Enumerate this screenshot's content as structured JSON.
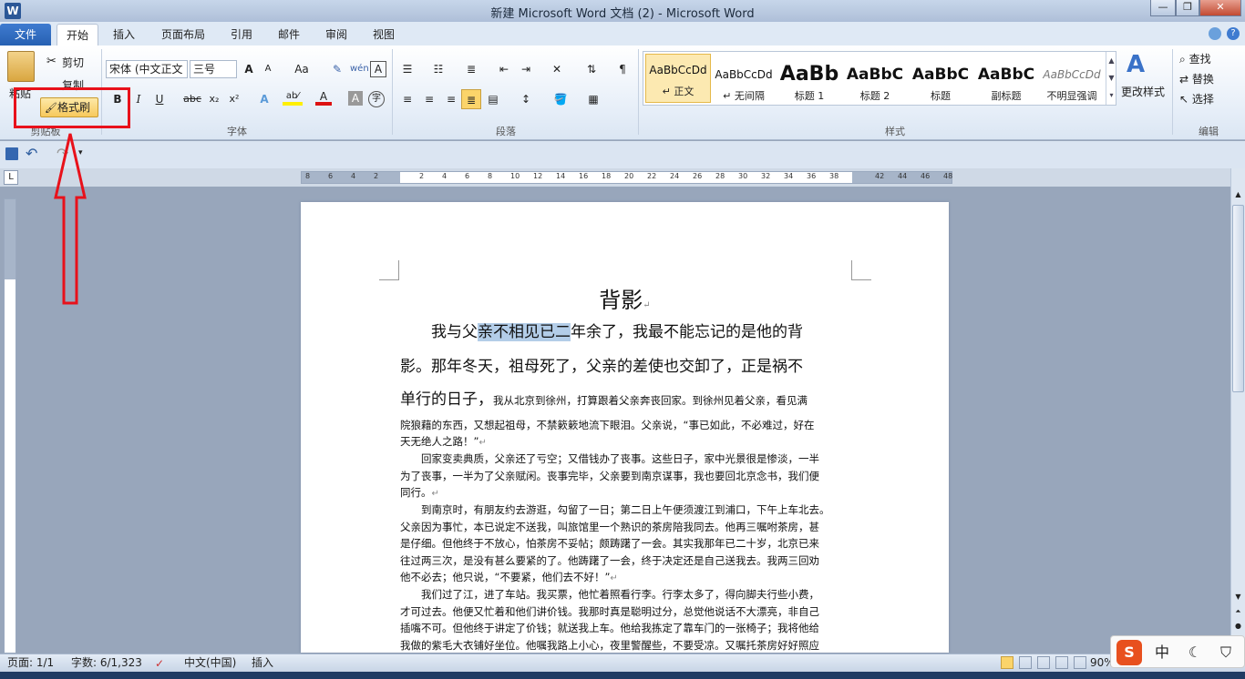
{
  "window": {
    "title": "新建 Microsoft Word 文档 (2)  -  Microsoft Word",
    "logo": "W",
    "minimize": "—",
    "restore": "❐",
    "close": "✕"
  },
  "tabs": [
    "文件",
    "开始",
    "插入",
    "页面布局",
    "引用",
    "邮件",
    "审阅",
    "视图"
  ],
  "clipboard": {
    "paste": "粘贴",
    "cut": "剪切",
    "copy": "复制",
    "format_painter": "格式刷",
    "group": "剪贴板"
  },
  "font": {
    "family": "宋体 (中文正文",
    "size": "三号",
    "grow": "A",
    "shrink": "A",
    "case": "Aa",
    "clear": "A",
    "bold": "B",
    "italic": "I",
    "underline": "U",
    "strike": "abc",
    "sub": "x₂",
    "sup": "x²",
    "color_a": "A",
    "char_border": "A",
    "enclose": "字",
    "group": "字体"
  },
  "paragraph": {
    "group": "段落"
  },
  "styles": {
    "group": "样式",
    "items": [
      {
        "preview": "AaBbCcDd",
        "name": "↵ 正文"
      },
      {
        "preview": "AaBbCcDd",
        "name": "↵ 无间隔"
      },
      {
        "preview": "AaBb",
        "name": "标题 1"
      },
      {
        "preview": "AaBbC",
        "name": "标题 2"
      },
      {
        "preview": "AaBbC",
        "name": "标题"
      },
      {
        "preview": "AaBbC",
        "name": "副标题"
      },
      {
        "preview": "AaBbCcDd",
        "name": "不明显强调"
      }
    ],
    "change": "更改样式"
  },
  "editing": {
    "find": "查找",
    "replace": "替换",
    "select": "选择",
    "group": "编辑"
  },
  "ruler": {
    "labels": [
      "8",
      "6",
      "4",
      "2",
      "",
      "2",
      "4",
      "6",
      "8",
      "10",
      "12",
      "14",
      "16",
      "18",
      "20",
      "22",
      "24",
      "26",
      "28",
      "30",
      "32",
      "34",
      "36",
      "38",
      "",
      "42",
      "44",
      "46",
      "48"
    ]
  },
  "document": {
    "title": "背影",
    "p1_before": "我与父",
    "p1_highlight": "亲不相见已二",
    "p1_after": "年余了，我最不能忘记的是他的背",
    "p1_line2": "影。那年冬天，祖母死了，父亲的差使也交卸了，正是祸不",
    "p1_line3_big": "单行的日子，",
    "p1_line3_small": "我从北京到徐州，打算跟着父亲奔丧回家。到徐州见着父亲，看见满",
    "p1_line4": "院狼藉的东西，又想起祖母，不禁簌簌地流下眼泪。父亲说，“事已如此，不必难过，好在",
    "p1_line5": "天无绝人之路！”",
    "p2": [
      "　　回家变卖典质，父亲还了亏空；又借钱办了丧事。这些日子，家中光景很是惨淡，一半",
      "为了丧事，一半为了父亲赋闲。丧事完毕，父亲要到南京谋事，我也要回北京念书，我们便",
      "同行。"
    ],
    "p3": [
      "　　到南京时，有朋友约去游逛，勾留了一日；第二日上午便须渡江到浦口，下午上车北去。",
      "父亲因为事忙，本已说定不送我，叫旅馆里一个熟识的茶房陪我同去。他再三嘱咐茶房，甚",
      "是仔细。但他终于不放心，怕茶房不妥帖；颇踌躇了一会。其实我那年已二十岁，北京已来",
      "往过两三次，是没有甚么要紧的了。他踌躇了一会，终于决定还是自己送我去。我两三回劝",
      "他不必去；他只说，“不要紧，他们去不好！”"
    ],
    "p4": [
      "　　我们过了江，进了车站。我买票，他忙着照看行李。行李太多了，得向脚夫行些小费，",
      "才可过去。他便又忙着和他们讲价钱。我那时真是聪明过分，总觉他说话不大漂亮，非自己",
      "插嘴不可。但他终于讲定了价钱；就送我上车。他给我拣定了靠车门的一张椅子；我将他给",
      "我做的紫毛大衣铺好坐位。他嘱我路上小心，夜里警醒些，不要受凉。又嘱托茶房好好照应"
    ],
    "para_mark": "↵"
  },
  "status": {
    "page": "页面: 1/1",
    "words": "字数: 6/1,323",
    "lang": "中文(中国)",
    "mode": "插入",
    "zoom": "90%"
  },
  "ime": {
    "logo": "S",
    "lang": "中",
    "moon": "☾",
    "shirt": "👕"
  },
  "icons": {
    "undo": "↶",
    "redo": "↷",
    "save": "💾"
  }
}
